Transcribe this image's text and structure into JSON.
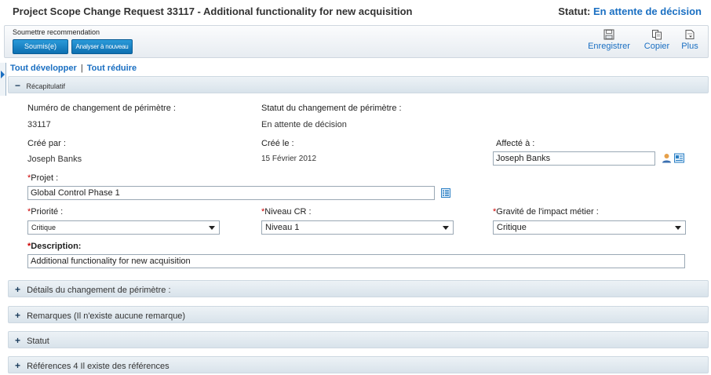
{
  "header": {
    "title": "Project Scope Change Request 33117 - Additional functionality for new acquisition",
    "status_label": "Statut:",
    "status_value": "En attente de décision"
  },
  "toolbar": {
    "caption": "Soumettre recommendation",
    "submit_label": "Soumis(e)",
    "reanalyse_label": "Analyser à nouveau",
    "save_label": "Enregistrer",
    "copy_label": "Copier",
    "more_label": "Plus"
  },
  "expand": {
    "expand_all": "Tout développer",
    "separator": "|",
    "collapse_all": "Tout réduire"
  },
  "summary": {
    "header": "Récapitulatif",
    "toggle": "−",
    "change_number_label": "Numéro de changement de périmètre :",
    "change_number_value": "33117",
    "change_status_label": "Statut du changement de périmètre :",
    "change_status_value": "En attente de décision",
    "created_by_label": "Créé par :",
    "created_by_value": "Joseph Banks",
    "created_on_label": "Créé le :",
    "created_on_value": "15 Février 2012",
    "assigned_to_label": "Affecté à :",
    "assigned_to_value": "Joseph Banks",
    "required_mark": "*",
    "project_label": "Projet :",
    "project_value": "Global Control Phase 1",
    "priority_label": "Priorité :",
    "priority_value": "Critique",
    "cr_level_label": "Niveau CR :",
    "cr_level_value": "Niveau 1",
    "impact_label": "Gravité de l'impact métier :",
    "impact_value": "Critique",
    "description_label": "Description:",
    "description_value": "Additional functionality for new acquisition"
  },
  "sections": [
    {
      "toggle": "+",
      "label": "Détails du changement de périmètre :"
    },
    {
      "toggle": "+",
      "label": "Remarques (Il n'existe aucune remarque)"
    },
    {
      "toggle": "+",
      "label": "Statut"
    },
    {
      "toggle": "+",
      "label": "Références 4 Il existe des références"
    }
  ],
  "colors": {
    "accent": "#1a6fc2",
    "button": "#1a82c8",
    "required": "#cc0000",
    "section_header": "#dfe7ee"
  },
  "icons": {
    "save": "floppy-disk-icon",
    "copy": "copy-documents-icon",
    "more": "more-document-icon",
    "user_picker": "user-icon",
    "directory": "address-book-icon",
    "project_list": "list-icon"
  }
}
